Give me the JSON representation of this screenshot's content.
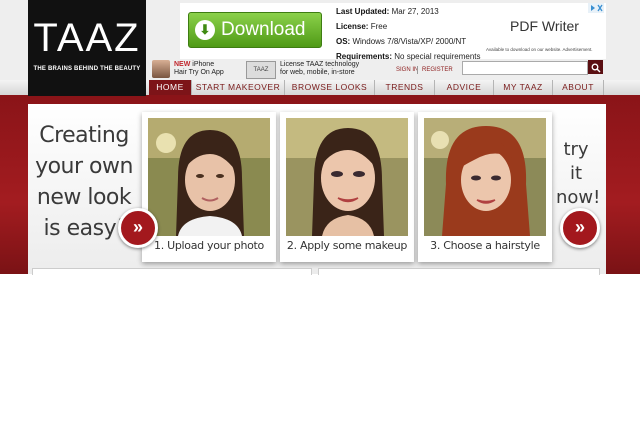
{
  "logo": {
    "text": "TAAZ",
    "tagline": "THE BRAINS BEHIND THE BEAUTY"
  },
  "ad": {
    "download_label": "Download",
    "last_updated_label": "Last Updated:",
    "last_updated_value": "Mar 27, 2013",
    "license_label": "License:",
    "license_value": "Free",
    "os_label": "OS:",
    "os_value": "Windows 7/8/Vista/XP/ 2000/NT",
    "requirements_label": "Requirements:",
    "requirements_value": "No special requirements",
    "product": "PDF Writer",
    "note": "Available to download on our website. Advertisement."
  },
  "promos": {
    "iphone_new": "NEW",
    "iphone_line1": "iPhone",
    "iphone_line2": "Hair Try On App",
    "license_line1": "License TAAZ technology",
    "license_line2": "for web, mobile, in-store"
  },
  "account": {
    "signin": "SIGN IN",
    "register": "REGISTER"
  },
  "search": {
    "placeholder": ""
  },
  "nav": {
    "items": [
      {
        "label": "HOME"
      },
      {
        "label": "START MAKEOVER"
      },
      {
        "label": "BROWSE LOOKS"
      },
      {
        "label": "TRENDS"
      },
      {
        "label": "ADVICE"
      },
      {
        "label": "MY TAAZ"
      },
      {
        "label": "ABOUT"
      }
    ]
  },
  "hero": {
    "headline": [
      "Creating",
      "your own",
      "new look",
      "is easy!"
    ],
    "try_now": [
      "try",
      "it",
      "now!"
    ],
    "arrow_glyph": "»",
    "steps": [
      {
        "caption": "1. Upload your photo"
      },
      {
        "caption": "2. Apply some makeup"
      },
      {
        "caption": "3. Choose a hairstyle"
      }
    ]
  },
  "colors": {
    "brand_red": "#a31c20",
    "dark_red": "#7d1418",
    "download_green": "#5fae22"
  }
}
